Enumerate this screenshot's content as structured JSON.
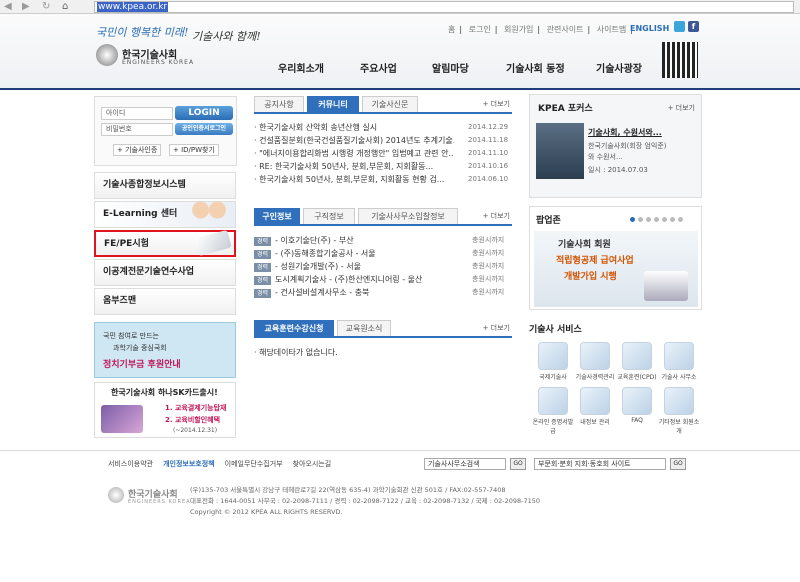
{
  "browser": {
    "url": "www.kpea.or.kr",
    "back": "◀",
    "forward": "▶",
    "refresh": "↻",
    "home": "⌂"
  },
  "header": {
    "slogan1": "국민이 행복한 미래!",
    "slogan2": "기술사와 함께!",
    "logo_ko": "한국기술사회",
    "logo_en": "ENGINEERS KOREA",
    "topnav": [
      "홈",
      "로그인",
      "회원가입",
      "관련사이트",
      "사이트맵"
    ],
    "english": "ENGLISH",
    "menu": [
      "우리회소개",
      "주요사업",
      "알림마당",
      "기술사회 동정",
      "기술사광장"
    ]
  },
  "login": {
    "id_placeholder": "아이디",
    "pw_placeholder": "비밀번호",
    "login_button": "LOGIN",
    "cert_button": "공인인증서로그인",
    "link1": "+ 기술사인증",
    "link2": "+ ID/PW찾기"
  },
  "left_menu": [
    "기술사종합정보시스템",
    "E-Learning 센터",
    "FE/PE시험",
    "이공계전문기술연수사업",
    "옴부즈맨"
  ],
  "left_banner1": {
    "line1": "국민 참여로 만드는",
    "line2": "과학기술 중심국회",
    "line3": "정치기부금 후원안내"
  },
  "left_banner2": {
    "title": "한국기술사회 하나SK카드출시!",
    "item1": "1. 교육결제기능탑재",
    "item2": "2. 교육비할인혜택",
    "period": "(~2014.12.31)"
  },
  "board1": {
    "tabs": [
      "공지사항",
      "커뮤니티",
      "기술사신문"
    ],
    "active": 1,
    "more": "+ 더보기",
    "rows": [
      {
        "title": "· 한국기술사회 산악회 송년산행 실시",
        "date": "2014.12.29"
      },
      {
        "title": "· 건설품질분회(한국건설품질기술사회) 2014년도 추계기술...",
        "date": "2014.11.18"
      },
      {
        "title": "· \"에너지이용합리화법 시행령 개정행안\" 입법예고 관련 안...",
        "date": "2014.11.10"
      },
      {
        "title": "· RE: 한국기술사회 50년사, 분회,부문회, 지회활동...",
        "date": "2014.10.16"
      },
      {
        "title": "· 한국기술사회 50년사, 분회,부문회, 지회활동 현황 검...",
        "date": "2014.06.10"
      }
    ]
  },
  "board2": {
    "tabs": [
      "구인정보",
      "구직정보",
      "기술사사무소입찰정보"
    ],
    "active": 0,
    "more": "+ 더보기",
    "badge": "경력",
    "rows": [
      {
        "title": "- 이호기술단(주) - 부산",
        "date": "충원시까지"
      },
      {
        "title": "- (주)동해종합기술공사 - 서울",
        "date": "충원시까지"
      },
      {
        "title": "- 성원기술개발(주) - 서울",
        "date": "충원시까지"
      },
      {
        "title": "도시계획기술사 - (주)한산엔지니어링 - 울산",
        "date": "충원시까지"
      },
      {
        "title": "- 건사설비설계사무소 - 충북",
        "date": "충원시까지"
      }
    ]
  },
  "board3": {
    "tabs": [
      "교육훈련수강신청",
      "교육원소식"
    ],
    "active": 0,
    "more": "+ 더보기",
    "empty": "· 해당데이타가 없습니다."
  },
  "focus": {
    "title": "KPEA 포커스",
    "more": "+ 더보기",
    "headline": "기술사회, 수원서와...",
    "desc1": "한국기술사회(회장 엄익준)",
    "desc2": "와 수원서...",
    "date": "일시 : 2014.07.03"
  },
  "popup": {
    "title": "팝업존",
    "line1": "기술사회 회원",
    "line2": "적립형공제 급여사업",
    "line3": "개발가입 시행"
  },
  "services": {
    "title": "기술사 서비스",
    "items": [
      "국제기술사",
      "기술사경력관리",
      "교육훈련(CPD)",
      "기술사 사무소",
      "온라인 증명서발급",
      "내정보 관리",
      "FAQ",
      "기타정보 회원소개"
    ]
  },
  "footer": {
    "links": [
      "서비스이용약관",
      "개인정보보호정책",
      "이메일무단수집거부",
      "찾아오시는길"
    ],
    "select1": "기술사사무소검색",
    "select2": "부문회·분회 지회·동호회 사이트",
    "go": "GO",
    "logo": "한국기술사회",
    "logo_en": "ENGINEERS KOREA",
    "addr1": "(우)135-703 서울특별시 강남구 테헤란로7길 22(역삼동 635-4) 과학기술회관 신관 501호 / FAX:02-557-7408",
    "addr2": "대표전화 : 1644-0051 사무국 : 02-2098-7111 / 경력 : 02-2098-7122 / 교육 : 02-2098-7132 / 국제 : 02-2098-7150",
    "copyright": "Copyright © 2012 KPEA ALL RIGHTS RESERVD."
  }
}
